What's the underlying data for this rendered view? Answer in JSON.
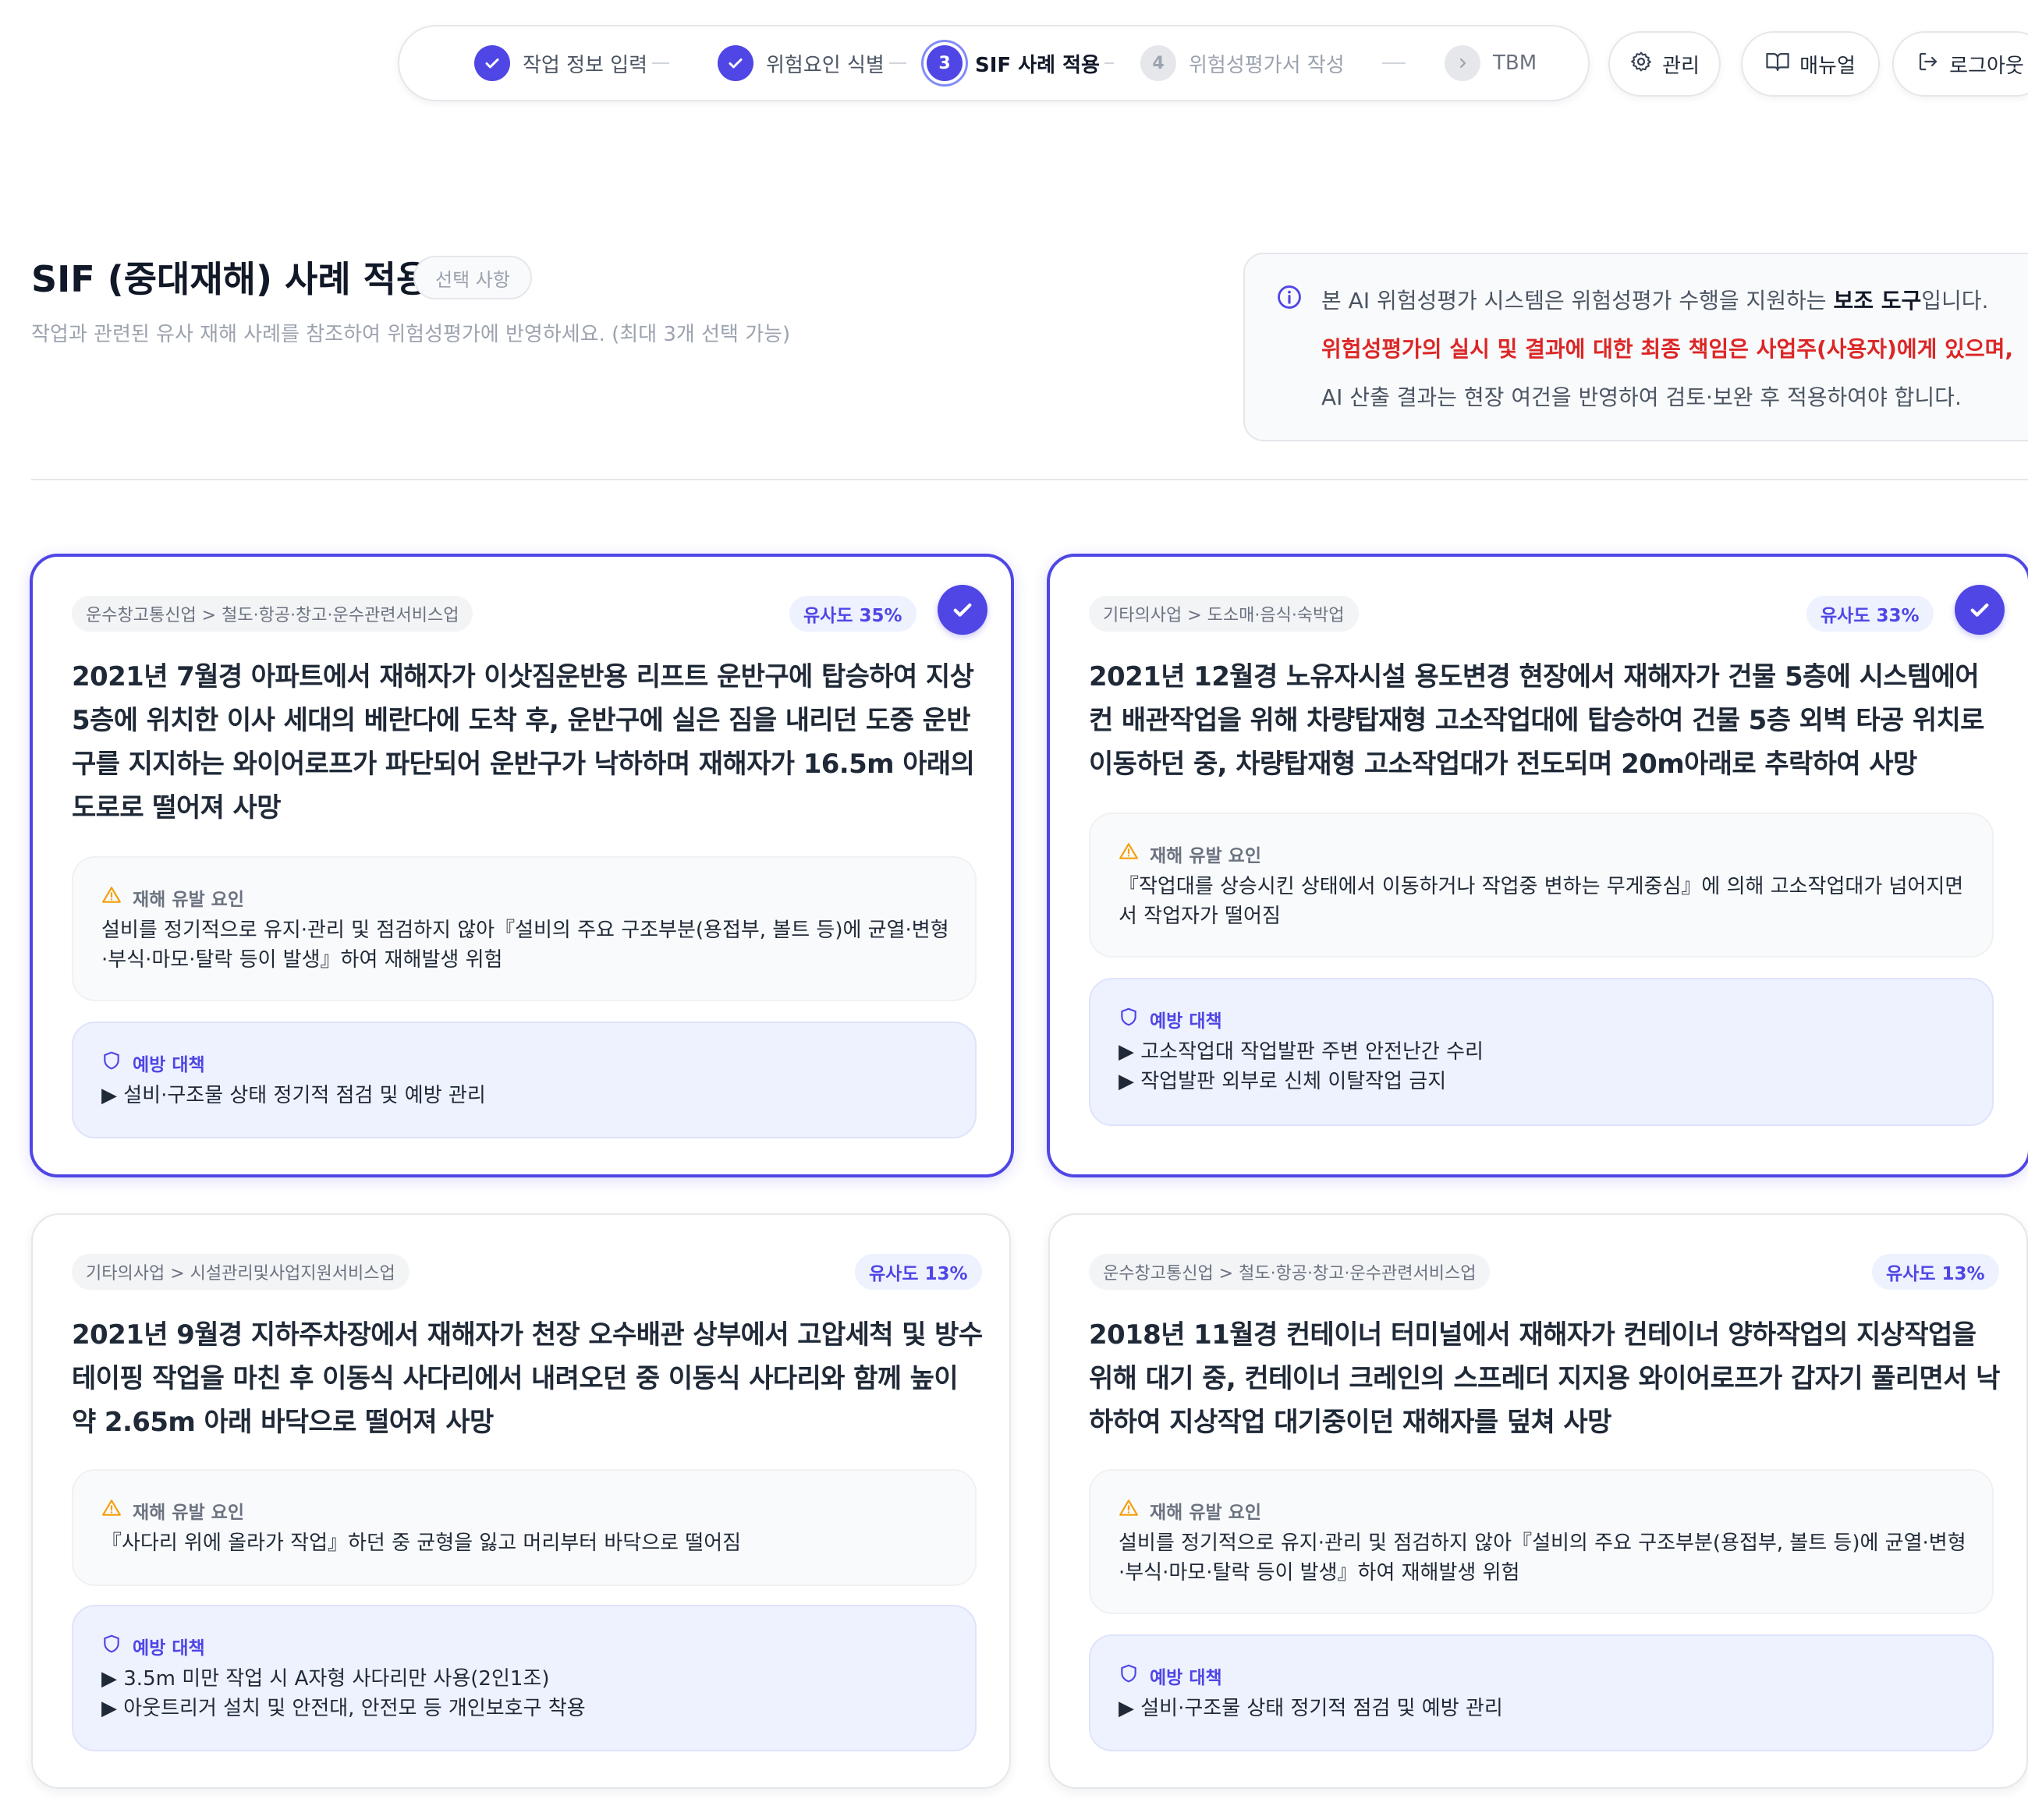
{
  "stepper": {
    "steps": [
      {
        "num": "✓",
        "label": "작업 정보 입력",
        "state": "done"
      },
      {
        "num": "✓",
        "label": "위험요인 식별",
        "state": "done"
      },
      {
        "num": "3",
        "label": "SIF 사례 적용",
        "state": "active"
      },
      {
        "num": "4",
        "label": "위험성평가서 작성",
        "state": "todo"
      },
      {
        "num": "›",
        "label": "TBM",
        "state": "todo"
      }
    ]
  },
  "top_buttons": {
    "admin": "관리",
    "manual": "매뉴얼",
    "logout": "로그아웃"
  },
  "header": {
    "title": "SIF (중대재해) 사례 적용",
    "optional_badge": "선택 사항",
    "subtitle": "작업과 관련된 유사 재해 사례를 참조하여 위험성평가에 반영하세요. (최대 3개 선택 가능)"
  },
  "notice": {
    "line1_prefix": "본 AI 위험성평가 시스템은 위험성평가 수행을 지원하는 ",
    "line1_bold": "보조 도구",
    "line1_suffix": "입니다.",
    "line2": "위험성평가의 실시 및 결과에 대한 최종 책임은 사업주(사용자)에게 있으며,",
    "line3": "AI 산출 결과는 현장 여건을 반영하여 검토·보완 후 적용하여야 합니다."
  },
  "labels": {
    "factor": "재해 유발 요인",
    "prevention": "예방 대책"
  },
  "cases": [
    {
      "category": "운수창고통신업 > 철도·항공·창고·운수관련서비스업",
      "similarity": "유사도 35%",
      "selected": true,
      "title": "2021년 7월경 아파트에서 재해자가 이삿짐운반용 리프트 운반구에 탑승하여 지상 5층에 위치한 이사 세대의 베란다에 도착 후, 운반구에 실은 짐을 내리던 도중 운반구를 지지하는 와이어로프가 파단되어 운반구가 낙하하며 재해자가 16.5m 아래의 도로로 떨어져 사망",
      "factor": "설비를 정기적으로 유지·관리 및 점검하지 않아『설비의 주요 구조부분(용접부, 볼트 등)에 균열·변형·부식·마모·탈락 등이 발생』하여 재해발생 위험",
      "prevention": [
        "▶ 설비·구조물 상태 정기적 점검 및 예방 관리"
      ]
    },
    {
      "category": "기타의사업 > 도소매·음식·숙박업",
      "similarity": "유사도 33%",
      "selected": true,
      "title": "2021년 12월경 노유자시설 용도변경 현장에서 재해자가 건물 5층에 시스템에어컨 배관작업을 위해 차량탑재형 고소작업대에 탑승하여 건물 5층 외벽 타공 위치로 이동하던 중, 차량탑재형 고소작업대가 전도되며 20m아래로 추락하여 사망",
      "factor": "『작업대를 상승시킨 상태에서 이동하거나 작업중 변하는 무게중심』에 의해 고소작업대가 넘어지면서 작업자가 떨어짐",
      "prevention": [
        "▶ 고소작업대 작업발판 주변 안전난간 수리",
        "▶ 작업발판 외부로 신체 이탈작업 금지"
      ]
    },
    {
      "category": "기타의사업 > 시설관리및사업지원서비스업",
      "similarity": "유사도 13%",
      "selected": false,
      "title": "2021년 9월경 지하주차장에서 재해자가 천장 오수배관 상부에서 고압세척 및 방수테이핑 작업을 마친 후 이동식 사다리에서 내려오던 중 이동식 사다리와 함께 높이 약 2.65m 아래 바닥으로 떨어져 사망",
      "factor": "『사다리 위에 올라가 작업』하던 중 균형을 잃고 머리부터 바닥으로 떨어짐",
      "prevention": [
        "▶ 3.5m 미만 작업 시 A자형 사다리만 사용(2인1조)",
        "▶ 아웃트리거 설치 및 안전대, 안전모 등 개인보호구 착용"
      ]
    },
    {
      "category": "운수창고통신업 > 철도·항공·창고·운수관련서비스업",
      "similarity": "유사도 13%",
      "selected": false,
      "title": "2018년 11월경 컨테이너 터미널에서 재해자가 컨테이너 양하작업의 지상작업을 위해 대기 중, 컨테이너 크레인의 스프레더 지지용 와이어로프가 갑자기 풀리면서 낙하하여 지상작업 대기중이던 재해자를 덮쳐 사망",
      "factor": "설비를 정기적으로 유지·관리 및 점검하지 않아『설비의 주요 구조부분(용접부, 볼트 등)에 균열·변형·부식·마모·탈락 등이 발생』하여 재해발생 위험",
      "prevention": [
        "▶ 설비·구조물 상태 정기적 점검 및 예방 관리"
      ]
    }
  ]
}
